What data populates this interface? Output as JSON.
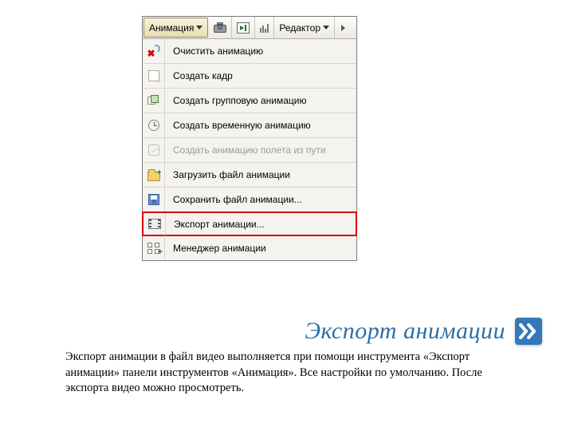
{
  "toolbar": {
    "animation_label": "Анимация",
    "editor_label": "Редактор"
  },
  "menu": {
    "items": [
      {
        "label": "Очистить анимацию",
        "icon": "clear-icon",
        "disabled": false
      },
      {
        "label": "Создать кадр",
        "icon": "frame-icon",
        "disabled": false
      },
      {
        "label": "Создать групповую анимацию",
        "icon": "group-icon",
        "disabled": false
      },
      {
        "label": "Создать временную анимацию",
        "icon": "clock-icon",
        "disabled": false
      },
      {
        "label": "Создать анимацию полета из пути",
        "icon": "flypath-icon",
        "disabled": true
      },
      {
        "label": "Загрузить файл анимации",
        "icon": "folder-open-icon",
        "disabled": false
      },
      {
        "label": "Сохранить файл анимации...",
        "icon": "save-icon",
        "disabled": false
      },
      {
        "label": "Экспорт анимации...",
        "icon": "film-icon",
        "disabled": false,
        "highlighted": true
      },
      {
        "label": "Менеджер анимации",
        "icon": "manager-icon",
        "disabled": false
      }
    ]
  },
  "slide": {
    "title": "Экспорт анимации",
    "body": "Экспорт анимации в файл видео выполняется при помощи инструмента «Экспорт анимации» панели инструментов «Анимация». Все настройки по умолчанию. После экспорта видео можно просмотреть."
  }
}
